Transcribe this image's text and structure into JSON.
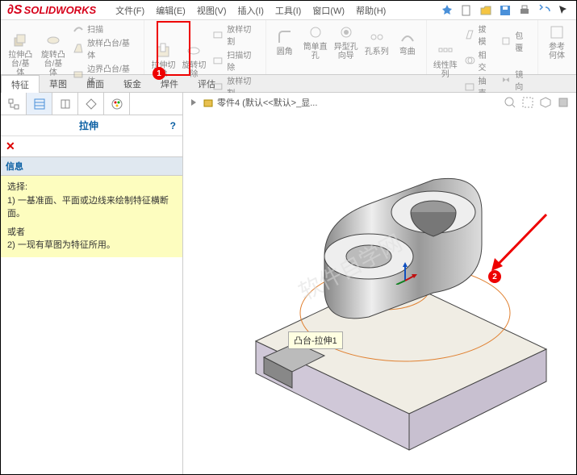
{
  "app": {
    "name": "SOLIDWORKS"
  },
  "menu": {
    "file": "文件(F)",
    "edit": "编辑(E)",
    "view": "视图(V)",
    "insert": "插入(I)",
    "tools": "工具(I)",
    "window": "窗口(W)",
    "help": "帮助(H)"
  },
  "ribbon": {
    "extrude": "拉伸凸\n台/基体",
    "revolve": "旋转凸\n台/基体",
    "sweep": "扫描",
    "loft": "放样凸台/基体",
    "boundary": "边界凸台/基体",
    "cut_extrude": "拉伸切\n除",
    "cut_revolve": "旋转切\n除",
    "cut_sweep": "放样切割",
    "cut_loft": "扫描切除",
    "cut_bound": "放样切割",
    "fillet": "圆角",
    "rib": "筒单直\n孔",
    "profile": "异型孔\n向导",
    "series": "孔系列",
    "bend": "弯曲",
    "pattern": "线性阵\n列",
    "draft": "拔模",
    "inter": "相交",
    "shell": "抽壳",
    "mirror": "镜向",
    "ref": "参考\n何体"
  },
  "tabs": {
    "feature": "特征",
    "sketch": "草图",
    "surface": "曲面",
    "sheet": "钣金",
    "weld": "焊件",
    "eval": "评估"
  },
  "panel": {
    "title": "拉伸",
    "info_hdr": "信息",
    "select_label": "选择:",
    "info1": "1) 一基准面、平面或边线来绘制特征横断面。",
    "or": "或者",
    "info2": "2) 一现有草图为特征所用。"
  },
  "doc": {
    "tab": "零件4  (默认<<默认>_显..."
  },
  "tooltip": {
    "text": "凸台-拉伸1"
  },
  "badges": {
    "b1": "1",
    "b2": "2"
  }
}
